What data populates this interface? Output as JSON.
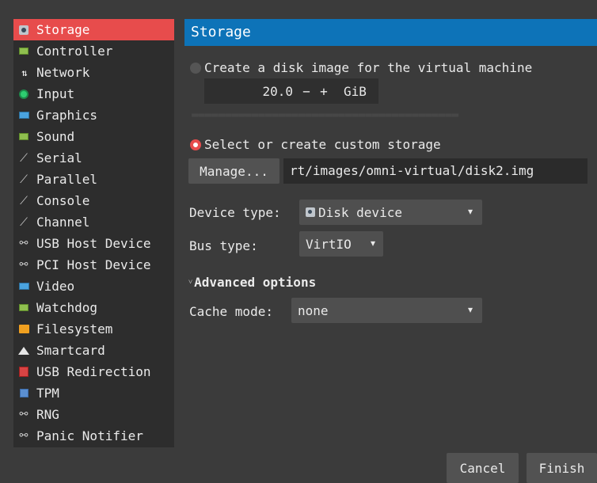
{
  "sidebar": {
    "items": [
      {
        "label": "Storage",
        "icon": "hdd-icon",
        "selected": true
      },
      {
        "label": "Controller",
        "icon": "board-icon"
      },
      {
        "label": "Network",
        "icon": "network-icon"
      },
      {
        "label": "Input",
        "icon": "input-icon"
      },
      {
        "label": "Graphics",
        "icon": "monitor-icon"
      },
      {
        "label": "Sound",
        "icon": "board-icon"
      },
      {
        "label": "Serial",
        "icon": "port-icon"
      },
      {
        "label": "Parallel",
        "icon": "port-icon"
      },
      {
        "label": "Console",
        "icon": "port-icon"
      },
      {
        "label": "Channel",
        "icon": "port-icon"
      },
      {
        "label": "USB Host Device",
        "icon": "usb-icon"
      },
      {
        "label": "PCI Host Device",
        "icon": "usb-icon"
      },
      {
        "label": "Video",
        "icon": "monitor-icon"
      },
      {
        "label": "Watchdog",
        "icon": "board-icon"
      },
      {
        "label": "Filesystem",
        "icon": "folder-icon"
      },
      {
        "label": "Smartcard",
        "icon": "smartcard-icon"
      },
      {
        "label": "USB Redirection",
        "icon": "redirection-icon"
      },
      {
        "label": "TPM",
        "icon": "tpm-icon"
      },
      {
        "label": "RNG",
        "icon": "usb-icon"
      },
      {
        "label": "Panic Notifier",
        "icon": "usb-icon"
      }
    ]
  },
  "main": {
    "title": "Storage",
    "create_disk_label": "Create a disk image for the virtual machine",
    "disk_size": "20.0",
    "minus": "−",
    "plus": "+",
    "unit": "GiB",
    "custom_storage_label": "Select or create custom storage",
    "manage_label": "Manage...",
    "storage_path": "rt/images/omni-virtual/disk2.img",
    "device_type_label": "Device type:",
    "device_type_value": "Disk device",
    "bus_type_label": "Bus type:",
    "bus_type_value": "VirtIO",
    "advanced_label": "Advanced options",
    "cache_mode_label": "Cache mode:",
    "cache_mode_value": "none"
  },
  "footer": {
    "cancel_label": "Cancel",
    "finish_label": "Finish"
  },
  "colors": {
    "accent": "#e74c4c",
    "title_bar": "#0d73b8",
    "background": "#3b3b3b"
  }
}
